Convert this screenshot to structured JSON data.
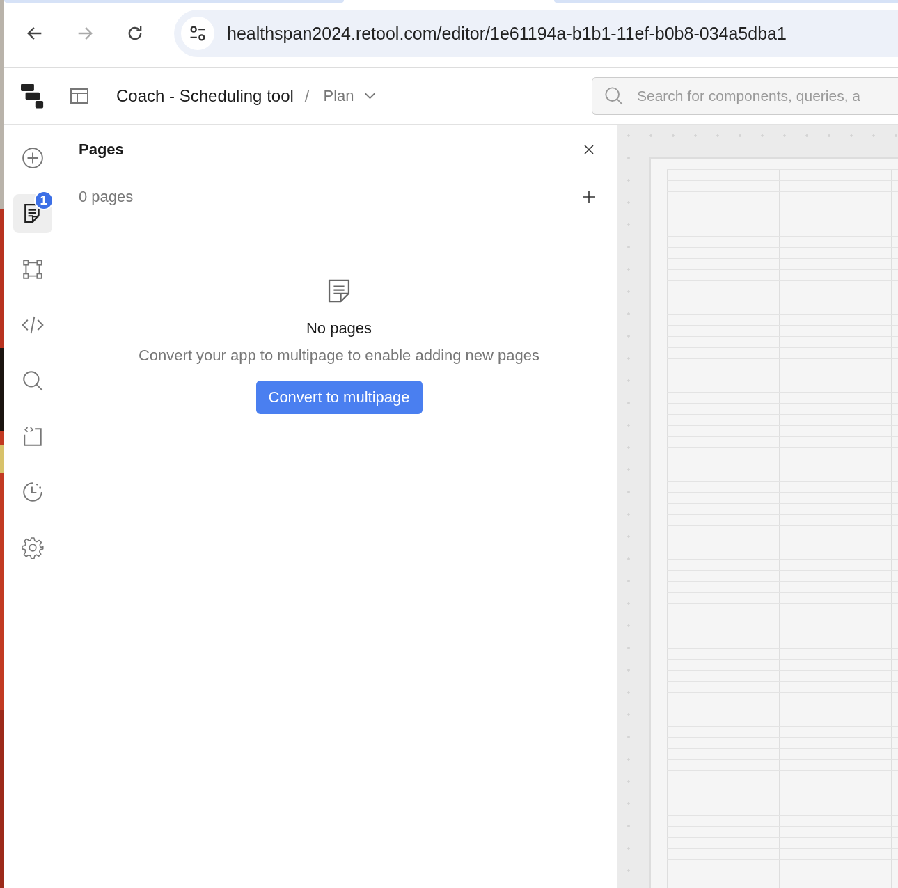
{
  "browser": {
    "url": "healthspan2024.retool.com/editor/1e61194a-b1b1-11ef-b0b8-034a5dba1",
    "forward_disabled": true
  },
  "header": {
    "app_name": "Coach - Scheduling tool",
    "separator": "/",
    "page": "Plan",
    "search": {
      "placeholder": "Search for components, queries, a"
    }
  },
  "rail": [
    {
      "kind": "add",
      "selected": false
    },
    {
      "kind": "pages",
      "selected": true,
      "badge": "1"
    },
    {
      "kind": "components",
      "selected": false
    },
    {
      "kind": "code",
      "selected": false
    },
    {
      "kind": "search",
      "selected": false
    },
    {
      "kind": "script",
      "selected": false
    },
    {
      "kind": "history",
      "selected": false
    },
    {
      "kind": "settings",
      "selected": false
    }
  ],
  "panel": {
    "title": "Pages",
    "count": "0 pages",
    "empty_title": "No pages",
    "empty_text": "Convert your app to multipage to enable adding new pages",
    "button": "Convert to multipage"
  }
}
